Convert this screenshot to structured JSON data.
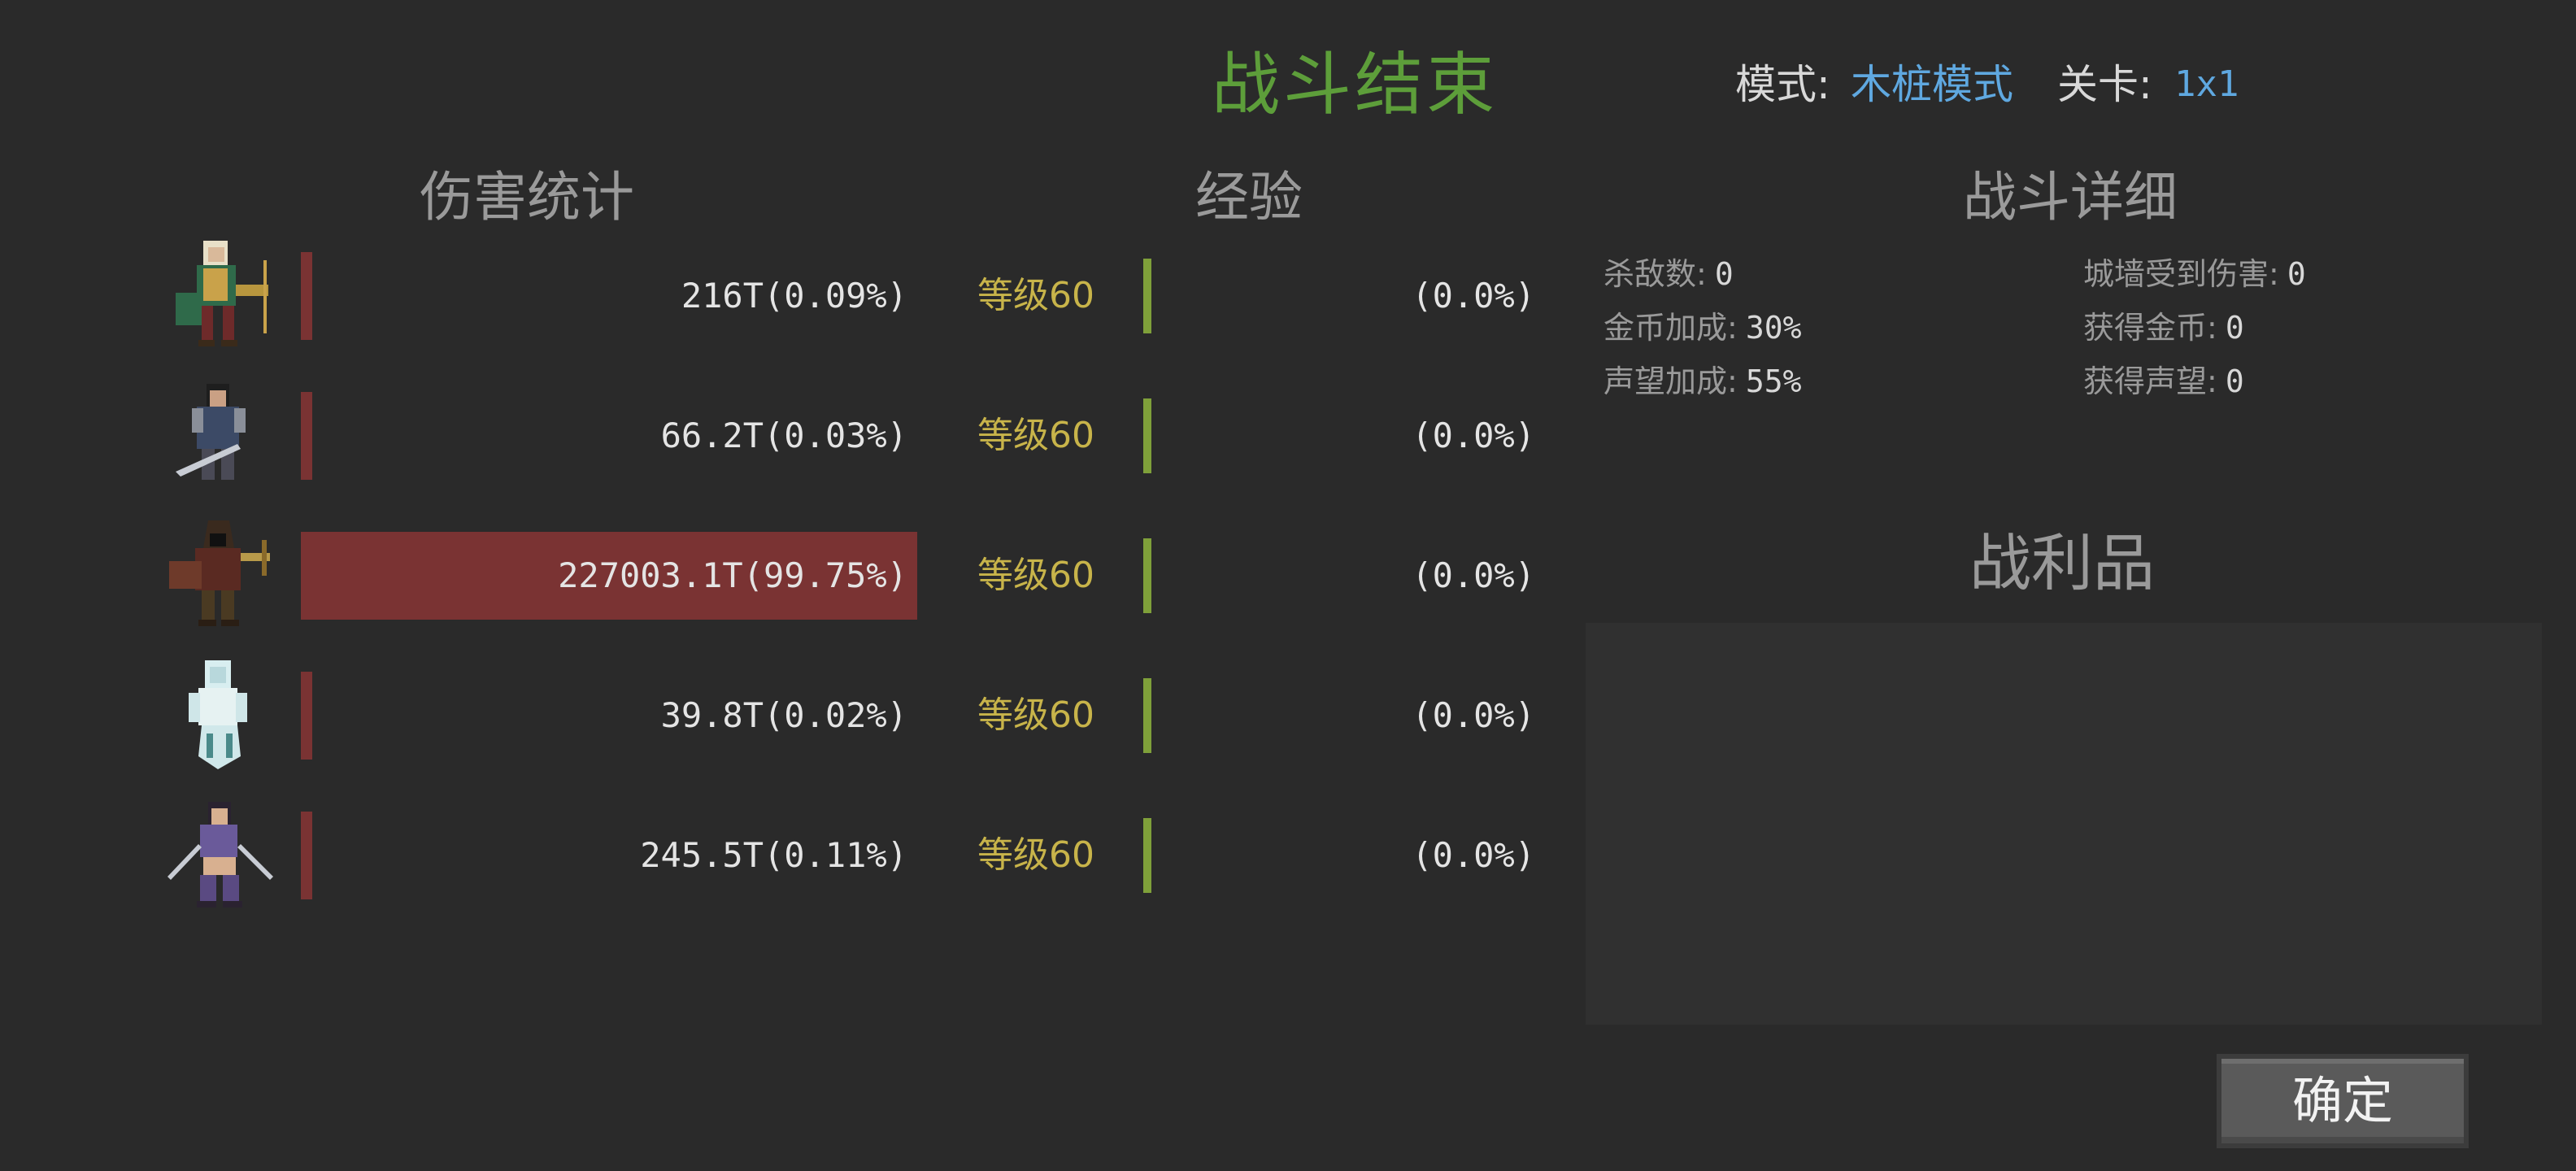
{
  "header": {
    "title": "战斗结束",
    "mode_label": "模式:",
    "mode_value": "木桩模式",
    "level_label": "关卡:",
    "level_value": "1x1"
  },
  "sections": {
    "damage": "伤害统计",
    "exp": "经验",
    "detail": "战斗详细",
    "loot": "战利品"
  },
  "heroes": [
    {
      "portrait_icon": "elf-archer-portrait-icon",
      "damage_text": "216T(0.09%)",
      "damage_share": 0.0009,
      "level_text": "等级60",
      "exp_text": "(0.0%)",
      "exp_share": 0
    },
    {
      "portrait_icon": "armored-swordsman-portrait-icon",
      "damage_text": "66.2T(0.03%)",
      "damage_share": 0.0003,
      "level_text": "等级60",
      "exp_text": "(0.0%)",
      "exp_share": 0
    },
    {
      "portrait_icon": "hooded-crossbow-portrait-icon",
      "damage_text": "227003.1T(99.75%)",
      "damage_share": 0.9975,
      "level_text": "等级60",
      "exp_text": "(0.0%)",
      "exp_share": 0
    },
    {
      "portrait_icon": "ghost-maiden-portrait-icon",
      "damage_text": "39.8T(0.02%)",
      "damage_share": 0.0002,
      "level_text": "等级60",
      "exp_text": "(0.0%)",
      "exp_share": 0
    },
    {
      "portrait_icon": "dual-blade-dancer-portrait-icon",
      "damage_text": "245.5T(0.11%)",
      "damage_share": 0.0011,
      "level_text": "等级60",
      "exp_text": "(0.0%)",
      "exp_share": 0
    }
  ],
  "detail": {
    "kills_label": "杀敌数:",
    "kills_value": "0",
    "wall_damage_label": "城墙受到伤害:",
    "wall_damage_value": "0",
    "gold_bonus_label": "金币加成:",
    "gold_bonus_value": "30%",
    "gold_gained_label": "获得金币:",
    "gold_gained_value": "0",
    "fame_bonus_label": "声望加成:",
    "fame_bonus_value": "55%",
    "fame_gained_label": "获得声望:",
    "fame_gained_value": "0"
  },
  "confirm_label": "确定",
  "colors": {
    "background": "#2a2a2a",
    "title_green": "#5d9e3a",
    "link_blue": "#5fa8e0",
    "damage_bar": "#7a3333",
    "exp_bar": "#7fa03a",
    "level_gold": "#c8b44a"
  }
}
